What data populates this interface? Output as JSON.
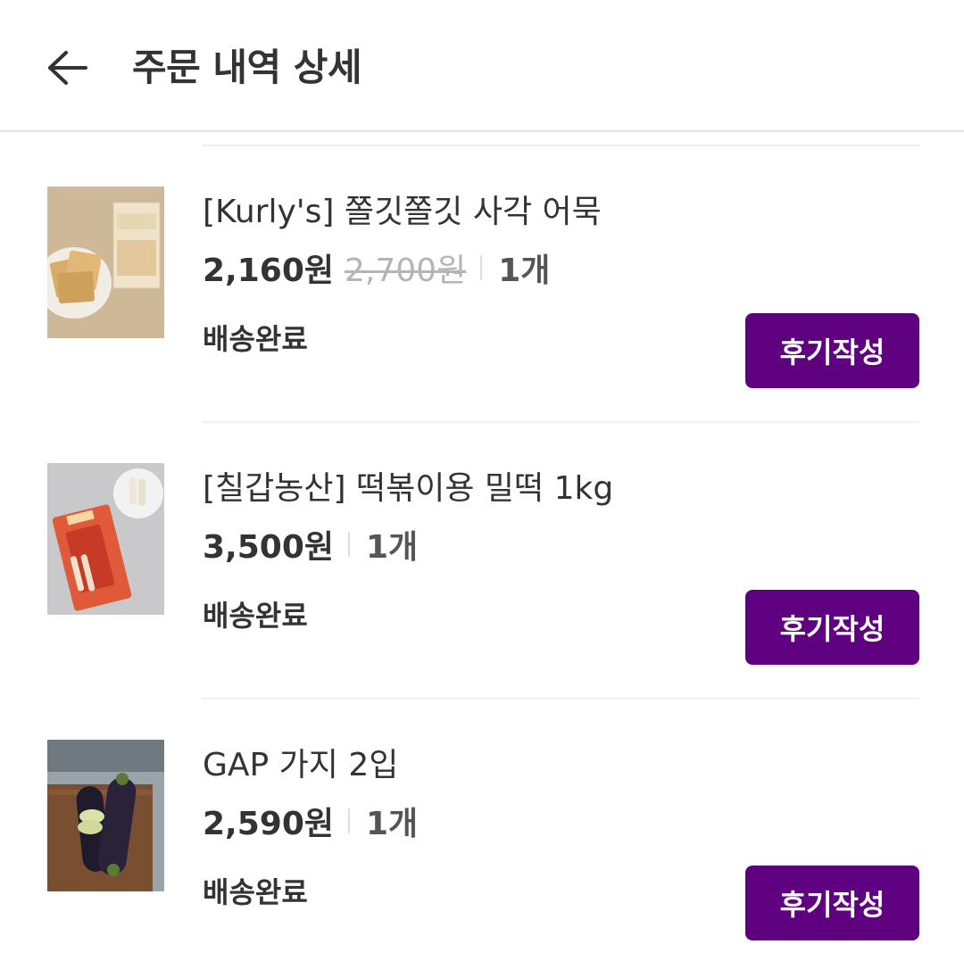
{
  "header": {
    "title": "주문 내역 상세",
    "back_icon": "arrow-left-icon"
  },
  "items": [
    {
      "name": "[Kurly's] 쫄깃쫄깃 사각 어묵",
      "price": "2,160원",
      "original_price": "2,700원",
      "quantity": "1개",
      "status": "배송완료",
      "review_label": "후기작성"
    },
    {
      "name": "[칠갑농산] 떡볶이용 밀떡 1kg",
      "price": "3,500원",
      "quantity": "1개",
      "status": "배송완료",
      "review_label": "후기작성"
    },
    {
      "name": "GAP 가지 2입",
      "price": "2,590원",
      "quantity": "1개",
      "status": "배송완료",
      "review_label": "후기작성"
    }
  ],
  "colors": {
    "accent": "#5f0080",
    "text": "#333333",
    "strike": "#b5b5b5",
    "divider": "#f0f0f0"
  }
}
